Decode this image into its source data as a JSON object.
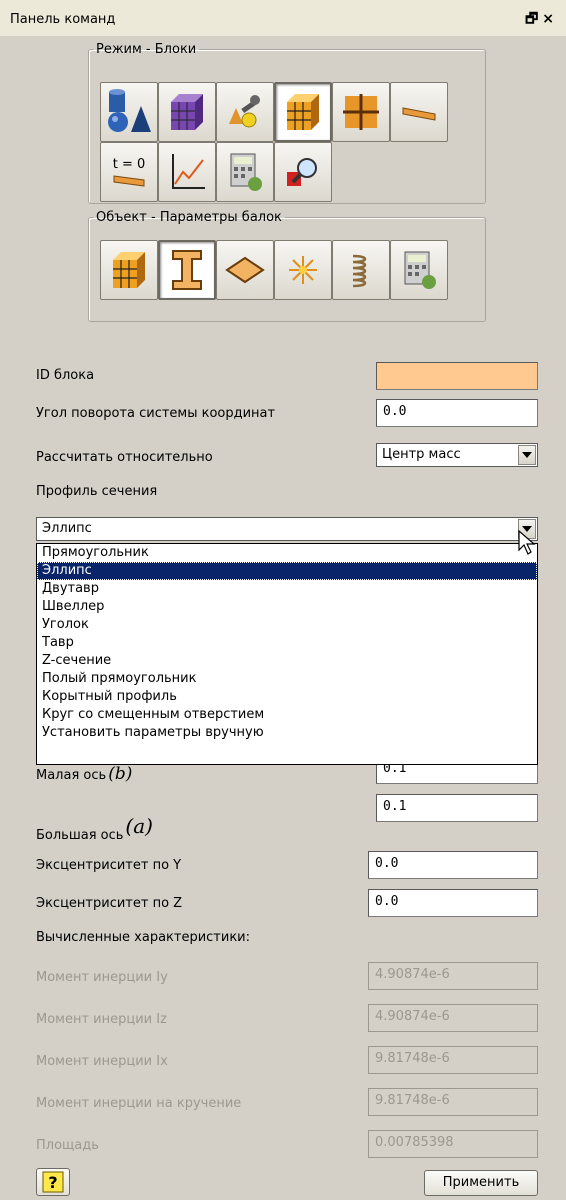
{
  "window": {
    "title": "Панель команд",
    "restore_icon": "restore-icon",
    "close_label": "×"
  },
  "mode_group": {
    "title": "Режим - Блоки",
    "buttons": [
      "geometry-icon",
      "mesh-icon",
      "settings-icon",
      "blocks-icon",
      "grid-icon",
      "beam-icon",
      "time-zero-icon",
      "graph-icon",
      "calculator-icon",
      "zoom-icon"
    ],
    "time_label": "t = 0"
  },
  "object_group": {
    "title": "Объект - Параметры балок",
    "buttons": [
      "blocks-icon",
      "i-beam-icon",
      "plate-icon",
      "point-icon",
      "spring-icon",
      "calculator-icon"
    ]
  },
  "form": {
    "block_id_label": "ID блока",
    "block_id_value": "",
    "rotation_label": "Угол поворота системы координат",
    "rotation_value": "0.0",
    "relative_label": "Рассчитать относительно",
    "relative_value": "Центр масс",
    "profile_label": "Профиль сечения",
    "profile_value": "Эллипс",
    "minor_axis_label": "Малая ось",
    "minor_axis_symbol": "(b)",
    "minor_axis_value": "0.1",
    "major_axis_label": "Большая ось",
    "major_axis_symbol": "(a)",
    "major_axis_value": "0.1",
    "ecc_y_label": "Эксцентриситет по Y",
    "ecc_y_value": "0.0",
    "ecc_z_label": "Эксцентриситет по Z",
    "ecc_z_value": "0.0",
    "computed_title": "Вычисленные характеристики:",
    "iy_label": "Момент инерции Iy",
    "iy_value": "4.90874e-6",
    "iz_label": "Момент инерции Iz",
    "iz_value": "4.90874e-6",
    "ix_label": "Момент инерции Ix",
    "ix_value": "9.81748e-6",
    "torsion_label": "Момент инерции на кручение",
    "torsion_value": "9.81748e-6",
    "area_label": "Площадь",
    "area_value": "0.00785398"
  },
  "dropdown": {
    "options": [
      "Прямоугольник",
      "Эллипс",
      "Двутавр",
      "Швеллер",
      "Уголок",
      "Тавр",
      "Z-сечение",
      "Полый прямоугольник",
      "Корытный профиль",
      "Круг со смещенным отверстием",
      "Установить параметры вручную"
    ],
    "selected_index": 1
  },
  "footer": {
    "help_icon": "help-icon",
    "apply_label": "Применить"
  },
  "colors": {
    "panel": "#d4d0c8",
    "highlight": "#0a246a",
    "id_field": "#ffc990"
  }
}
